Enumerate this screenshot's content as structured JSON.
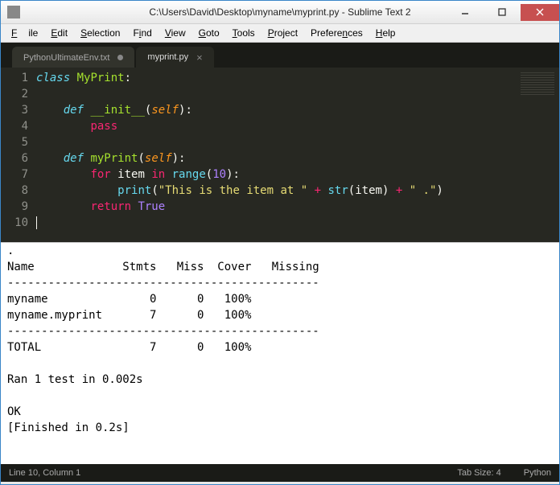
{
  "window": {
    "title": "C:\\Users\\David\\Desktop\\myname\\myprint.py - Sublime Text 2"
  },
  "menubar": {
    "file": "File",
    "edit": "Edit",
    "selection": "Selection",
    "find": "Find",
    "view": "View",
    "goto": "Goto",
    "tools": "Tools",
    "project": "Project",
    "preferences": "Preferences",
    "help": "Help"
  },
  "tabs": [
    {
      "label": "PythonUltimateEnv.txt",
      "dirty": true,
      "active": false
    },
    {
      "label": "myprint.py",
      "dirty": false,
      "active": true
    }
  ],
  "code": {
    "line_count": 10,
    "l1_class": "class",
    "l1_name": "MyPrint",
    "l1_colon": ":",
    "l3_def": "def",
    "l3_name": "__init__",
    "l3_open": "(",
    "l3_self": "self",
    "l3_close": "):",
    "l4_pass": "pass",
    "l6_def": "def",
    "l6_name": "myPrint",
    "l6_open": "(",
    "l6_self": "self",
    "l6_close": "):",
    "l7_for": "for",
    "l7_item": "item",
    "l7_in": "in",
    "l7_range": "range",
    "l7_open": "(",
    "l7_num": "10",
    "l7_close": "):",
    "l8_print": "print",
    "l8_open": "(",
    "l8_str1": "\"This is the item at \"",
    "l8_plus1": "+",
    "l8_strfn": "str",
    "l8_open2": "(",
    "l8_item": "item",
    "l8_close2": ")",
    "l8_plus2": "+",
    "l8_str2": "\" .\"",
    "l8_close": ")",
    "l9_return": "return",
    "l9_true": "True"
  },
  "console_output": ".\nName             Stmts   Miss  Cover   Missing\n----------------------------------------------\nmyname               0      0   100%\nmyname.myprint       7      0   100%\n----------------------------------------------\nTOTAL                7      0   100%\n\nRan 1 test in 0.002s\n\nOK\n[Finished in 0.2s]",
  "statusbar": {
    "position": "Line 10, Column 1",
    "tab_size": "Tab Size: 4",
    "syntax": "Python"
  }
}
